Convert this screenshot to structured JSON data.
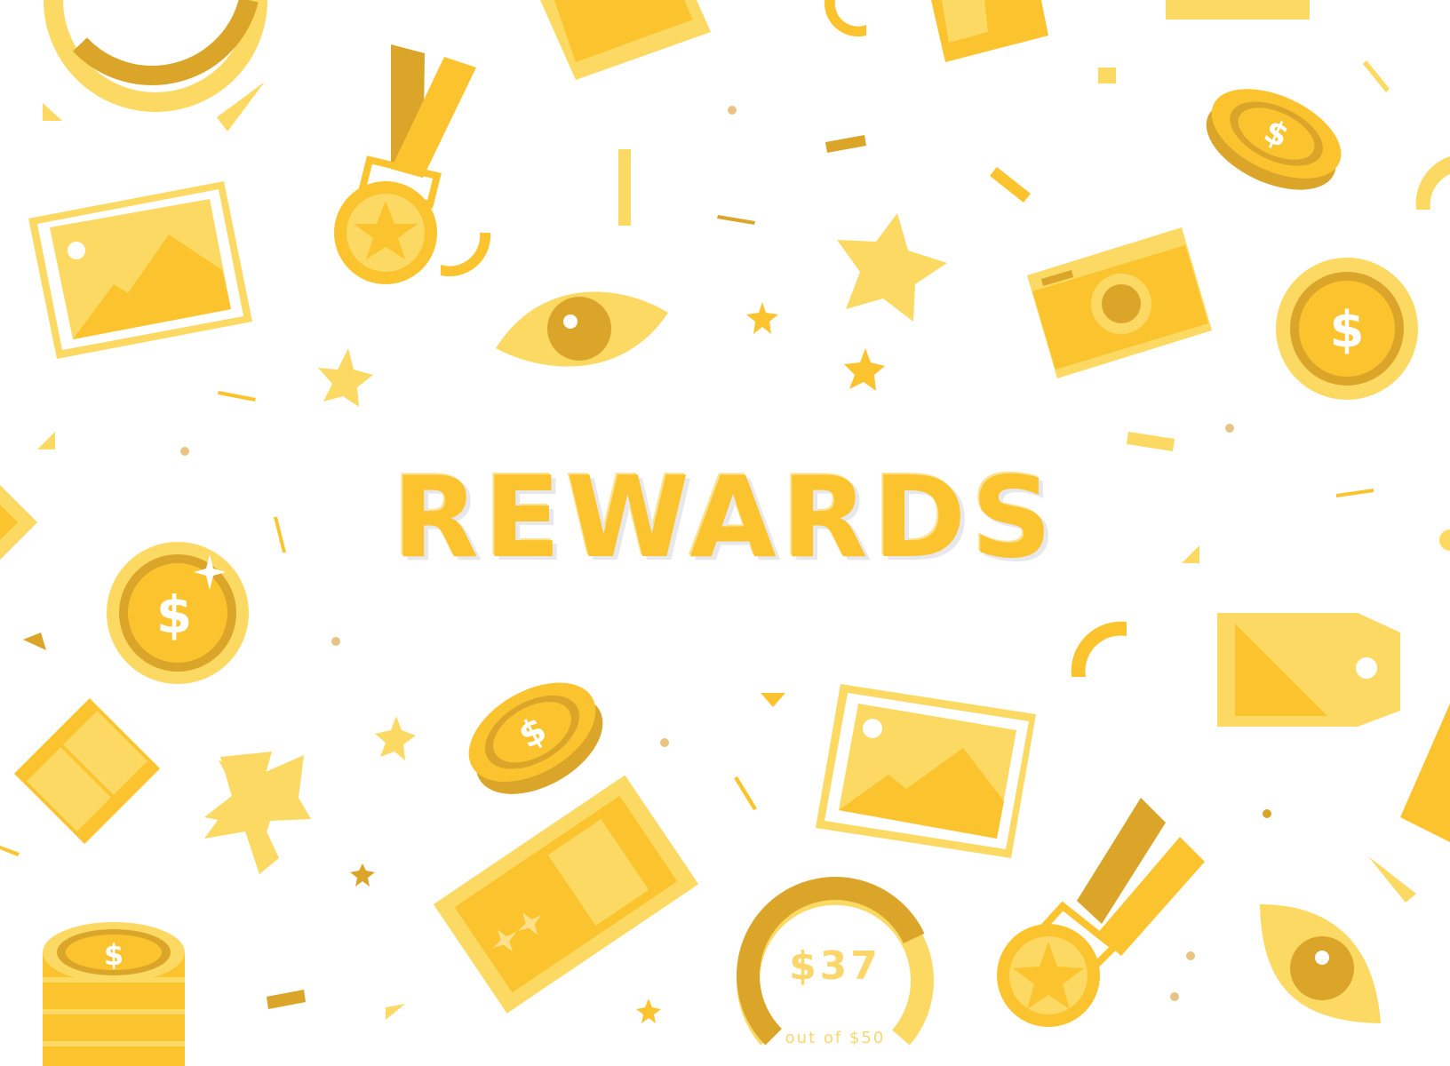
{
  "title": "REWARDS",
  "gauge": {
    "value_text": "$37",
    "caption": "out of $50",
    "current": 37,
    "max": 50
  },
  "colors": {
    "yellow": "#FBC42E",
    "light_yellow": "#FBD962",
    "dark_yellow": "#DBA52A",
    "pale_yellow": "#FDE08A",
    "background": "#FFFFFF"
  }
}
